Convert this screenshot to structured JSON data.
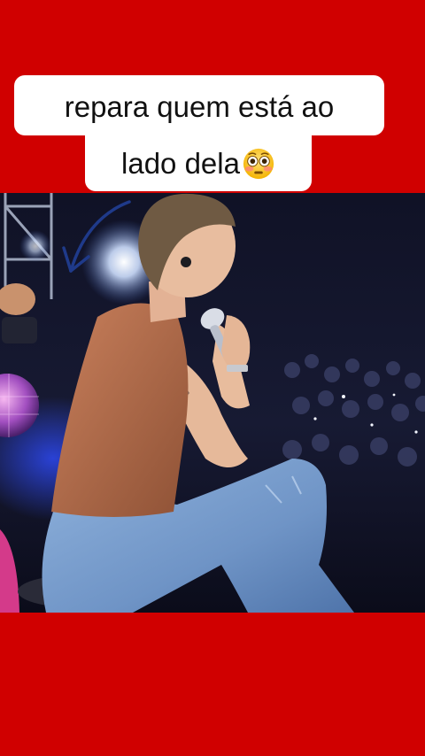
{
  "caption": {
    "line1": "repara quem está ao",
    "line2": "lado dela"
  },
  "emoji": "flushed-face",
  "colors": {
    "background": "#d00000",
    "caption_bg": "#ffffff",
    "caption_text": "#111111",
    "arrow": "#1f3a8a"
  }
}
